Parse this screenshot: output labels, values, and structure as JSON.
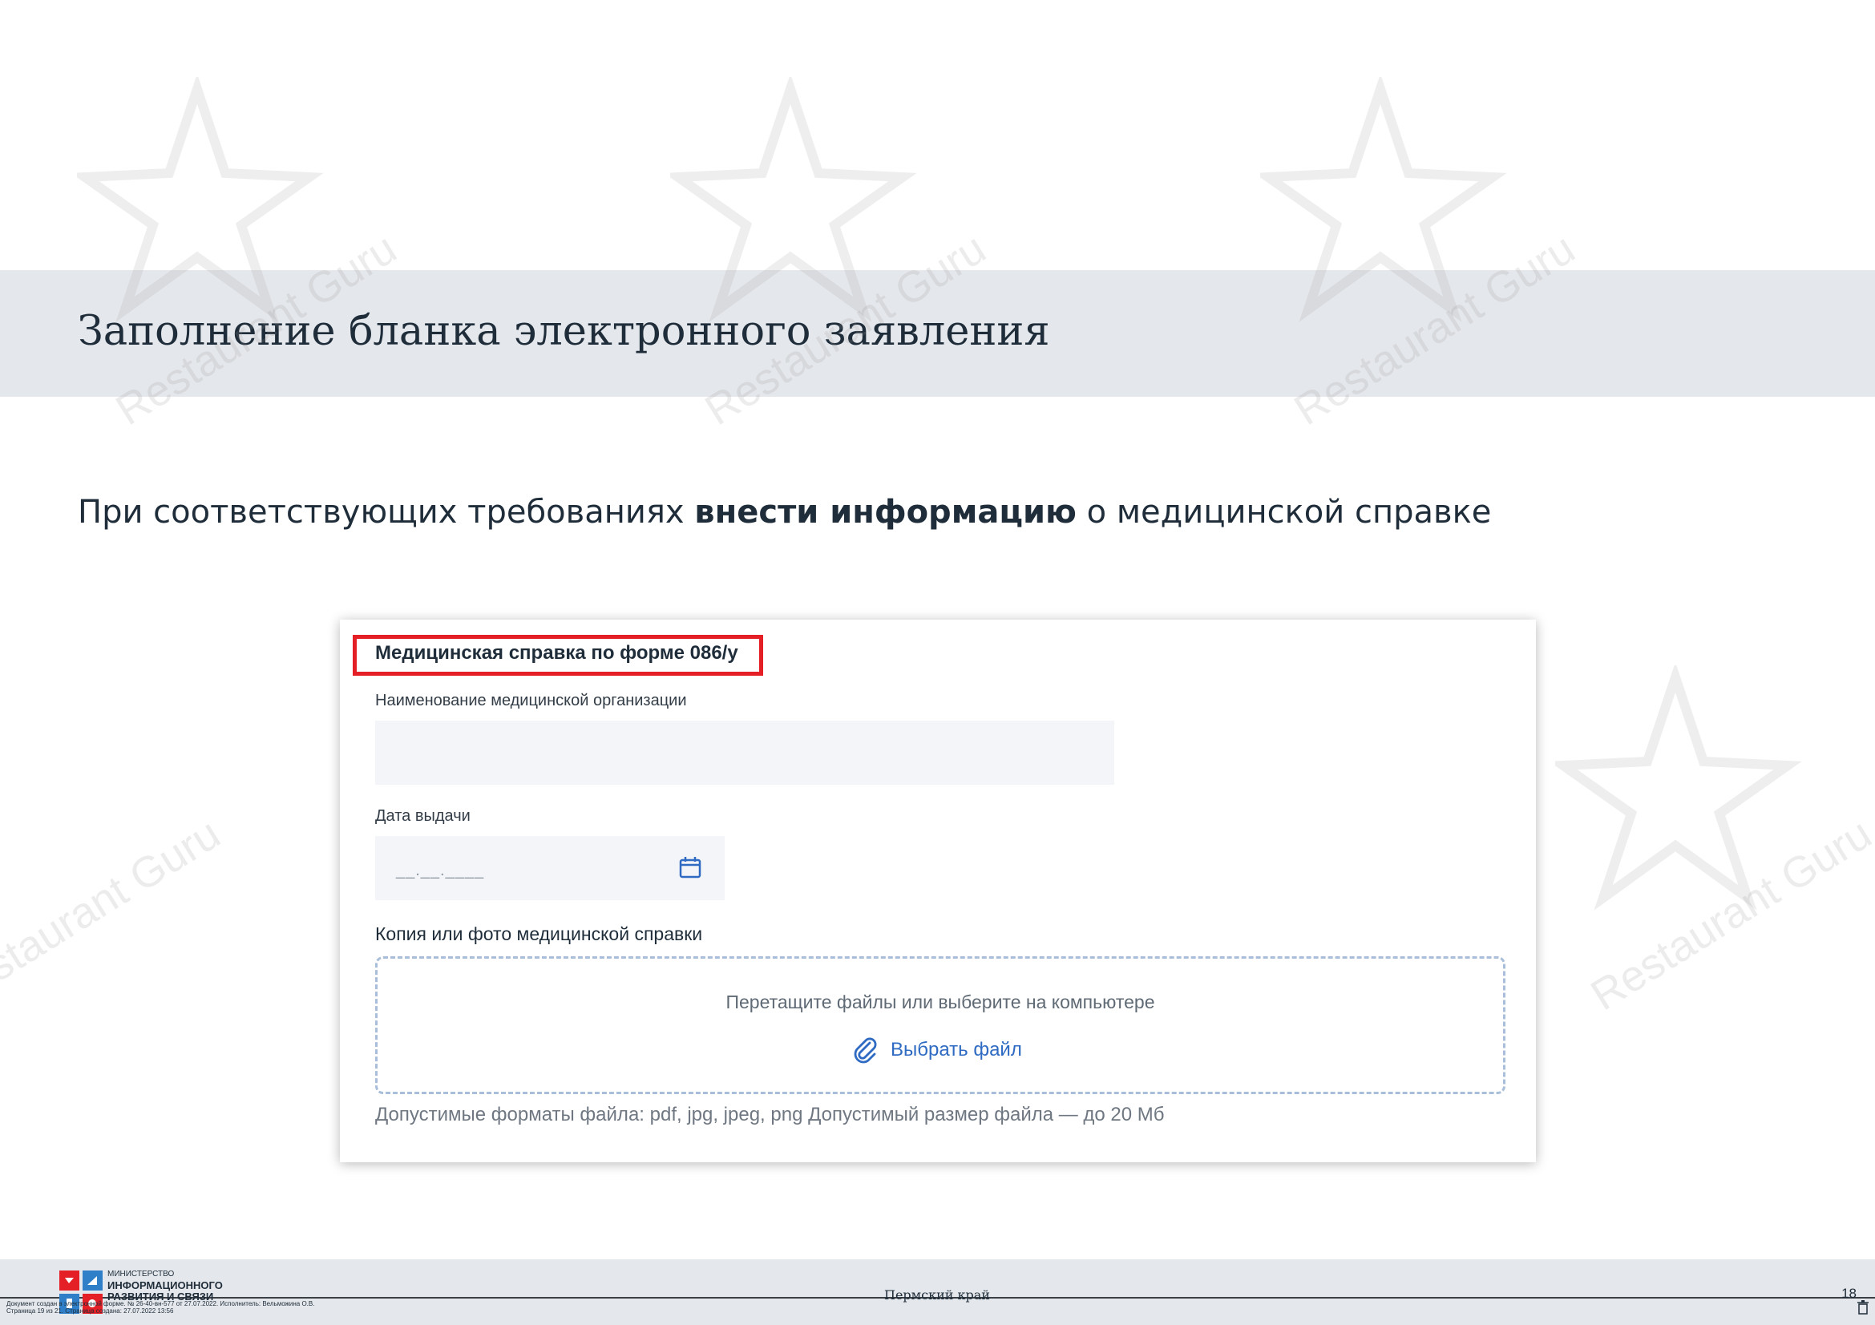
{
  "page": {
    "title": "Заполнение бланка электронного заявления",
    "subtitle_pre": "При соответствующих требованиях ",
    "subtitle_bold": "внести информацию",
    "subtitle_post": " о медицинской справке"
  },
  "form": {
    "section_title": "Медицинская справка по форме 086/у",
    "org_label": "Наименование медицинской организации",
    "org_value": "",
    "date_label": "Дата выдачи",
    "date_placeholder": "__.__.____",
    "copy_label": "Копия или фото медицинской справки",
    "dropzone_hint": "Перетащите файлы или выберите на компьютере",
    "choose_file_label": "Выбрать файл",
    "formats_note": "Допустимые форматы файла: pdf, jpg, jpeg, png Допустимый размер файла — до 20 Мб",
    "highlight_color": "#e41f25",
    "link_color": "#2f6bc2"
  },
  "watermark": {
    "text": "Restaurant Guru"
  },
  "footer": {
    "ministry_line1": "МИНИСТЕРСТВО",
    "ministry_line2": "ИНФОРМАЦИОННОГО",
    "ministry_line3": "РАЗВИТИЯ И СВЯЗИ",
    "region": "Пермский край",
    "page_number": "18",
    "doc_meta_line1": "Документ создан в электронной форме. № 26-40-вн-577 от 27.07.2022. Исполнитель: Вельможина О.В.",
    "doc_meta_line2": "Страница 19 из 21. Страница создана: 27.07.2022 13:56"
  }
}
